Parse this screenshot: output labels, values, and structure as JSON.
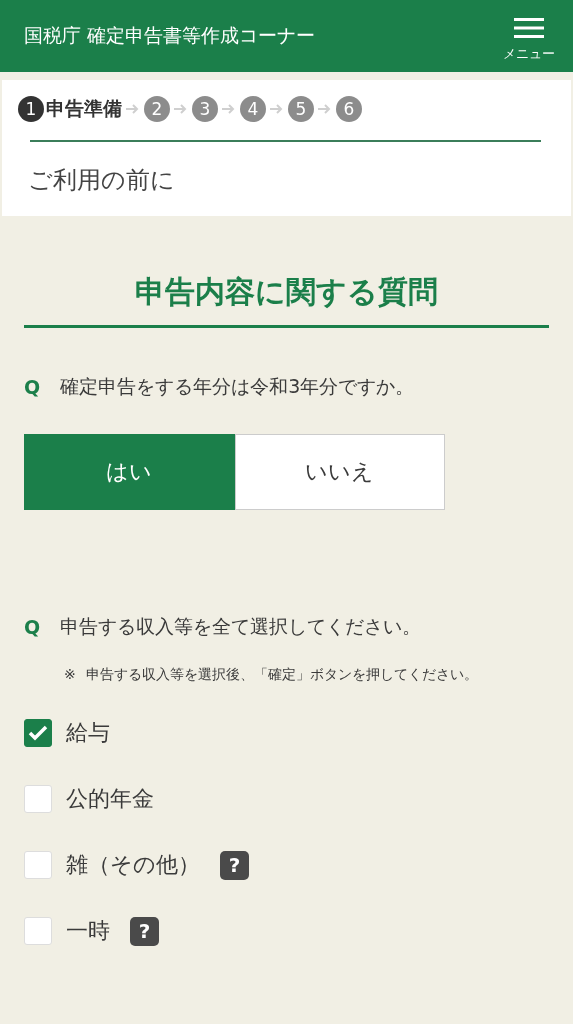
{
  "header": {
    "title": "国税庁 確定申告書等作成コーナー",
    "menu_label": "メニュー"
  },
  "steps": [
    {
      "number": "1",
      "label": "申告準備",
      "selected": true
    },
    {
      "number": "2",
      "selected": false
    },
    {
      "number": "3",
      "selected": false
    },
    {
      "number": "4",
      "selected": false
    },
    {
      "number": "5",
      "selected": false
    },
    {
      "number": "6",
      "selected": false
    }
  ],
  "step_title": "ご利用の前に",
  "section_title": "申告内容に関する質問",
  "question_1": {
    "marker": "Q",
    "text": "確定申告をする年分は令和3年分ですか。",
    "options": [
      {
        "label": "はい",
        "selected": true
      },
      {
        "label": "いいえ",
        "selected": false
      }
    ]
  },
  "question_2": {
    "marker": "Q",
    "text": "申告する収入等を全て選択してください。",
    "note_mark": "※",
    "note": "申告する収入等を選択後、「確定」ボタンを押してください。",
    "items": [
      {
        "label": "給与",
        "checked": true
      },
      {
        "label": "公的年金",
        "checked": false
      },
      {
        "label": "雑（その他）",
        "checked": false,
        "help": "?"
      },
      {
        "label": "一時",
        "checked": false,
        "help": "?"
      }
    ]
  }
}
